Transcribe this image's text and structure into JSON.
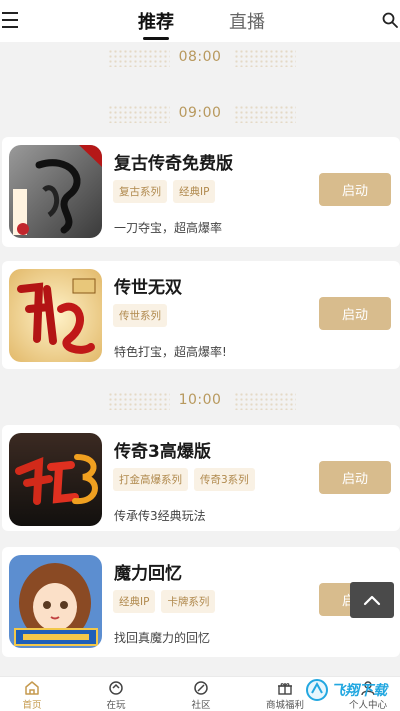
{
  "header": {
    "tabs": [
      {
        "label": "推荐",
        "active": true
      },
      {
        "label": "直播",
        "active": false
      }
    ]
  },
  "times": [
    "08:00",
    "09:00",
    "10:00"
  ],
  "games": [
    {
      "title": "复古传奇免费版",
      "tags": [
        "复古系列",
        "经典IP"
      ],
      "desc": "一刀夺宝，超高爆率",
      "button": "启动",
      "icon": "dragon-game-icon"
    },
    {
      "title": "传世无双",
      "tags": [
        "传世系列"
      ],
      "desc": "特色打宝，超高爆率!",
      "button": "启动",
      "icon": "chuanshi-game-icon"
    },
    {
      "title": "传奇3高爆版",
      "tags": [
        "打金高爆系列",
        "传奇3系列"
      ],
      "desc": "传承传3经典玩法",
      "button": "启动",
      "icon": "chuanqi3-game-icon"
    },
    {
      "title": "魔力回忆",
      "tags": [
        "经典IP",
        "卡牌系列"
      ],
      "desc": "找回真魔力的回忆",
      "button": "启动",
      "icon": "anime-girl-game-icon"
    }
  ],
  "bottom_nav": [
    {
      "label": "首页",
      "active": true
    },
    {
      "label": "在玩",
      "active": false
    },
    {
      "label": "社区",
      "active": false
    },
    {
      "label": "商城福利",
      "active": false
    },
    {
      "label": "个人中心",
      "active": false
    }
  ],
  "watermark": "飞翔下载",
  "colors": {
    "accent": "#c59a4e",
    "button": "#d8bc8d",
    "tag_bg": "#f9f1e4",
    "tag_text": "#b0894d",
    "time": "#b8995e"
  }
}
